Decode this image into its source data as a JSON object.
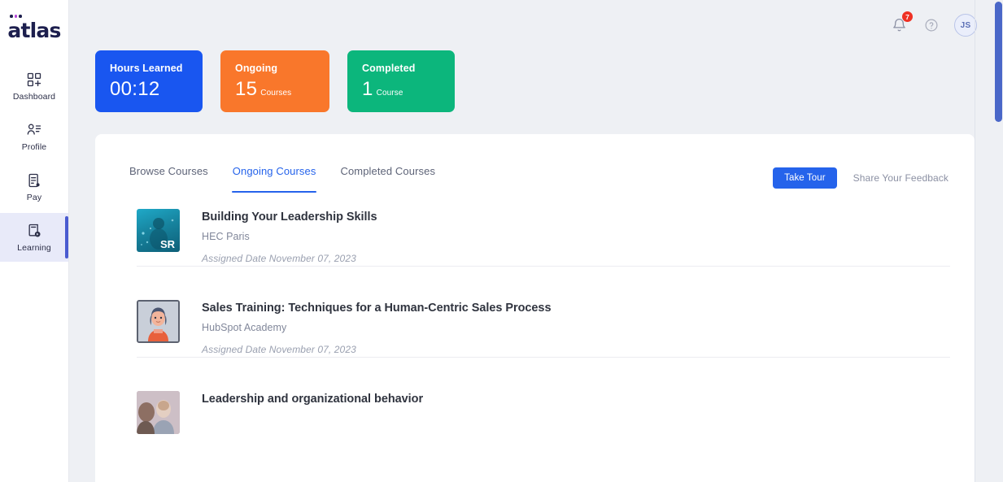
{
  "brand": {
    "name": "atlas"
  },
  "sidebar": {
    "items": [
      {
        "label": "Dashboard",
        "icon": "dashboard-grid-plus-icon",
        "active": false
      },
      {
        "label": "Profile",
        "icon": "person-list-icon",
        "active": false
      },
      {
        "label": "Pay",
        "icon": "document-pay-icon",
        "active": false
      },
      {
        "label": "Learning",
        "icon": "book-play-icon",
        "active": true
      }
    ]
  },
  "topbar": {
    "notification_count": "7",
    "notification_icon": "bell-icon",
    "help_icon": "help-circle-icon",
    "avatar_initials": "JS"
  },
  "stats": [
    {
      "title": "Hours Learned",
      "value": "00:12",
      "unit": "",
      "color": "#1956f0"
    },
    {
      "title": "Ongoing",
      "value": "15",
      "unit": "Courses",
      "color": "#f9772b"
    },
    {
      "title": "Completed",
      "value": "1",
      "unit": "Course",
      "color": "#0cb67c"
    }
  ],
  "panel": {
    "tabs": [
      {
        "label": "Browse Courses",
        "active": false
      },
      {
        "label": "Ongoing Courses",
        "active": true
      },
      {
        "label": "Completed Courses",
        "active": false
      }
    ],
    "take_tour_label": "Take Tour",
    "feedback_label": "Share Your Feedback"
  },
  "courses": [
    {
      "title": "Building Your Leadership Skills",
      "provider": "HEC Paris",
      "date": "Assigned Date November 07, 2023",
      "thumb_kind": "underwater-teal",
      "thumb_badge": "SR"
    },
    {
      "title": "Sales Training: Techniques for a Human-Centric Sales Process",
      "provider": "HubSpot Academy",
      "date": "Assigned Date November 07, 2023",
      "thumb_kind": "avatar-illustration",
      "thumb_badge": ""
    },
    {
      "title": "Leadership and organizational behavior",
      "provider": "",
      "date": "",
      "thumb_kind": "photo-people",
      "thumb_badge": ""
    }
  ],
  "colors": {
    "accent_blue": "#2563eb",
    "page_bg": "#eef0f4",
    "sidebar_active_bg": "#e8eaf9",
    "scrollbar": "#4a67c8"
  }
}
